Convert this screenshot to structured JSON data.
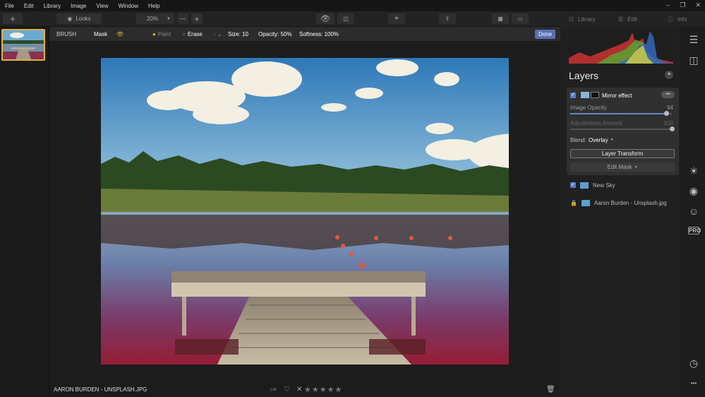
{
  "menu": [
    "File",
    "Edit",
    "Library",
    "Image",
    "View",
    "Window",
    "Help"
  ],
  "toolbar": {
    "looks_label": "Looks",
    "zoom_value": "20%",
    "minus": "—",
    "plus": "+",
    "add": "+"
  },
  "right_tabs": {
    "library": "Library",
    "edit": "Edit",
    "info": "Info"
  },
  "brushbar": {
    "tool": "BRUSH",
    "mask": "Mask",
    "paint": "Paint",
    "erase": "Erase",
    "size": "Size: 10",
    "opacity": "Opacity: 50%",
    "softness": "Softness: 100%",
    "done": "Done"
  },
  "bottom": {
    "filename": "AARON BURDEN - UNSPLASH.JPG",
    "rating": "★★★★★",
    "reject": "✕"
  },
  "layers": {
    "title": "Layers",
    "add": "+",
    "mirror": {
      "name": "Mirror effect",
      "more": "•••",
      "opacity_label": "Image Opacity",
      "opacity_value": "94",
      "adjust_label": "Adjustments Amount",
      "adjust_value": "100",
      "blend_label": "Blend:",
      "blend_value": "Overlay",
      "transform": "Layer Transform",
      "edit_mask": "Edit Mask"
    },
    "items": [
      {
        "name": "New Sky"
      },
      {
        "name": "Aaron Burden - Unsplash.jpg"
      }
    ]
  },
  "side_icons": [
    "layers-icon",
    "compare-icon",
    "sun-icon",
    "palette-icon",
    "face-icon",
    "pro-icon",
    "history-icon",
    "more-icon"
  ],
  "pro_label": "PRO",
  "more_dots": "•••",
  "colors": {
    "accent": "#5a6fb8",
    "selection": "#e2b13c",
    "bg": "#1a1a1a"
  }
}
